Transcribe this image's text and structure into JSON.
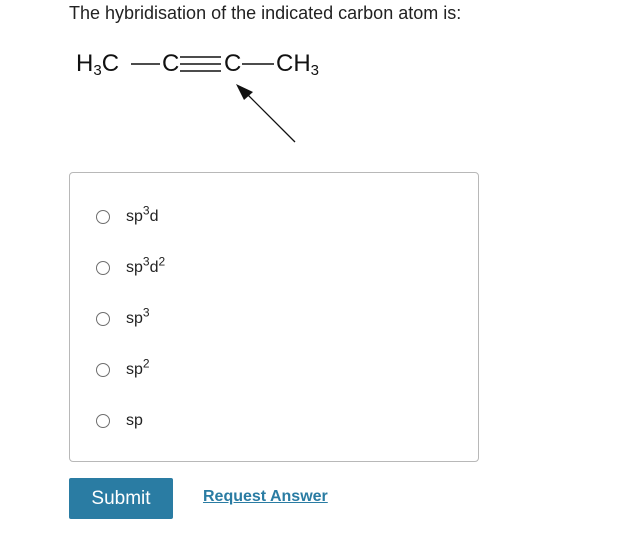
{
  "question": {
    "text": "The hybridisation of the indicated carbon atom is:"
  },
  "molecule": {
    "left_group": {
      "text": "H",
      "sub": "3",
      "tail": "C"
    },
    "carbon_a": "C",
    "carbon_b": "C",
    "right_group": {
      "text": "CH",
      "sub": "3"
    }
  },
  "options": [
    {
      "base": "sp",
      "sup": "3",
      "tail": "d",
      "sup2": ""
    },
    {
      "base": "sp",
      "sup": "3",
      "tail": "d",
      "sup2": "2"
    },
    {
      "base": "sp",
      "sup": "3",
      "tail": "",
      "sup2": ""
    },
    {
      "base": "sp",
      "sup": "2",
      "tail": "",
      "sup2": ""
    },
    {
      "base": "sp",
      "sup": "",
      "tail": "",
      "sup2": ""
    }
  ],
  "actions": {
    "submit_label": "Submit",
    "request_answer_label": "Request Answer"
  },
  "colors": {
    "accent": "#2a7ca3",
    "border": "#b8b8b8"
  }
}
